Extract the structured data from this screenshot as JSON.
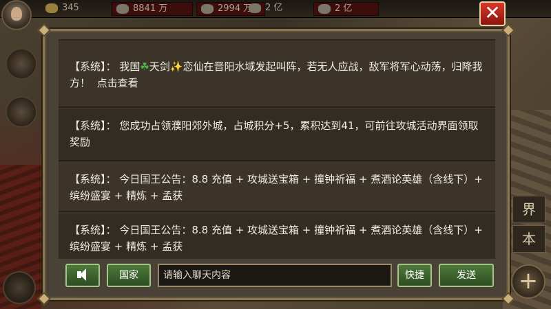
{
  "topbar": {
    "res1": "345",
    "res2": "8841 万",
    "res3": "2994 万",
    "res4": "2 亿",
    "res5": "2 亿"
  },
  "chat": {
    "messages": [
      {
        "tag": "【系统】",
        "sep": "：",
        "pre": "我国",
        "leaf_icon": "☘",
        "name_a": "天剑",
        "spark_icon": "✨",
        "post": "恋仙在晋阳水域发起叫阵，若无人应战，敌军将军心动荡，归降我方！",
        "link": "点击查看"
      },
      {
        "tag": "【系统】",
        "sep": "：",
        "text": "您成功占领濮阳郊外城，占城积分+5，累积达到41，可前往攻城活动界面领取奖励"
      },
      {
        "tag": "【系统】",
        "sep": "：",
        "text": "今日国王公告：8.8 充值 + 攻城送宝箱 + 撞钟祈福 + 煮酒论英雄（含线下）+ 缤纷盛宴 + 精炼 + 孟获"
      },
      {
        "tag": "【系统】",
        "sep": "：",
        "text": "今日国王公告：8.8 充值 + 攻城送宝箱 + 撞钟祈福 + 煮酒论英雄（含线下）+ 缤纷盛宴 + 精炼 + 孟获"
      }
    ]
  },
  "controls": {
    "voice_icon": "speaker-icon",
    "country_label": "国家",
    "input_placeholder": "请输入聊天内容",
    "quick_label": "快捷",
    "send_label": "发送",
    "close_glyph": "✕"
  },
  "side": {
    "right_tag_1": "界",
    "right_tag_2": "本",
    "plus_glyph": "+"
  }
}
